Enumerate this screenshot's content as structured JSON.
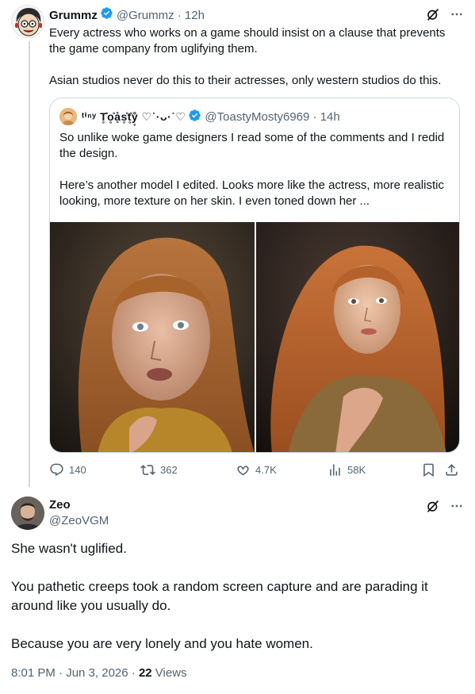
{
  "post1": {
    "author_name": "Grummz",
    "author_handle": "@Grummz",
    "time": "12h",
    "text_p1": "Every actress who works on a game should insist on a clause that prevents the game company from uglifying them.",
    "text_p2": "Asian studios never do this to their actresses, only western studios do this."
  },
  "quote": {
    "author_name": "ᵗⁱⁿʸ T̥̊o̥̊ḁ̊s̥̊t̥̊ẙ̥ ♡˙·ᴗ·˙♡",
    "author_handle": "@ToastyMosty6969",
    "time": "14h",
    "text_p1": "So unlike woke game designers I read some of the comments and I redid the design.",
    "text_p2": "Here’s another model I edited. Looks more like the actress, more realistic looking, more texture on her skin. I even toned down her ..."
  },
  "actions": {
    "replies": "140",
    "reposts": "362",
    "likes": "4.7K",
    "views": "58K"
  },
  "post2": {
    "author_name": "Zeo",
    "author_handle": "@ZeoVGM",
    "text_p1": "She wasn't uglified.",
    "text_p2": "You pathetic creeps took a random screen capture and are parading it around like you usually do.",
    "text_p3": "Because you are very lonely and you hate women.",
    "timestamp": "8:01 PM · Jun 3, 2026",
    "view_count": "22",
    "views_label": "Views"
  },
  "separator": " · ",
  "colors": {
    "text_primary": "#0f1419",
    "text_secondary": "#536471",
    "verified_blue": "#1d9bf0",
    "border": "#cfd9de"
  },
  "icons": [
    "verified-badge-icon",
    "grok-icon",
    "more-icon",
    "reply-icon",
    "repost-icon",
    "like-icon",
    "views-icon",
    "bookmark-icon",
    "share-icon"
  ]
}
